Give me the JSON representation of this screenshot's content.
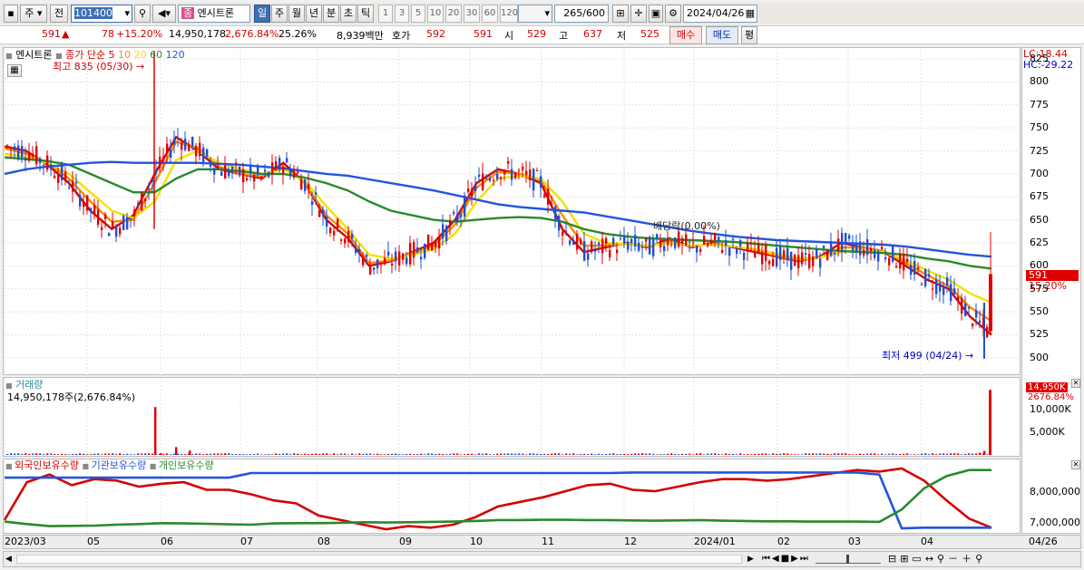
{
  "toolbar": {
    "market_btn": "주",
    "prev_btn": "전",
    "code": "101400",
    "stock_badge": "종",
    "stock_name": "엔시트론",
    "periods": [
      "일",
      "주",
      "월",
      "년",
      "분",
      "초",
      "틱"
    ],
    "selected_period": "일",
    "minute_periods": [
      "1",
      "3",
      "5",
      "10",
      "20",
      "30",
      "60",
      "120"
    ],
    "count": "265",
    "count_total": "/600",
    "date": "2024/04/26"
  },
  "quote": {
    "price": "591",
    "arrow": "▲",
    "change": "78",
    "change_pct": "+15.20%",
    "volume": "14,950,178",
    "volume_pct": "2,676.84%",
    "turnover": "25.26%",
    "amount": "8,939백만",
    "bid_label": "호가",
    "ask": "592",
    "bid": "591",
    "open_label": "시",
    "open": "529",
    "high_label": "고",
    "high": "637",
    "low_label": "저",
    "low": "525",
    "buy_btn": "매수",
    "sell_btn": "매도",
    "eval_btn": "평"
  },
  "price_panel": {
    "legend_name": "엔시트론",
    "legend_ma": "종가 단순",
    "ma_periods": [
      "5",
      "10",
      "20",
      "60",
      "120"
    ],
    "ma_colors": [
      "#d40000",
      "#ff8c00",
      "#f5e000",
      "#2a8a2a",
      "#2255dd"
    ],
    "max_label": "최고 835 (05/30)",
    "min_label": "최저 499 (04/24)",
    "dividend_label": "배당락(0.00%)",
    "lc_label": "LC:18.44",
    "hc_label": "HC:-29.22",
    "price_tag": "591",
    "pct_tag": "15.20%",
    "y_ticks": [
      "825",
      "800",
      "775",
      "750",
      "725",
      "700",
      "675",
      "650",
      "625",
      "600",
      "575",
      "550",
      "525",
      "500"
    ]
  },
  "volume_panel": {
    "title": "거래량",
    "readout": "14,950,178주(2,676.84%)",
    "tag_value": "14,950K",
    "tag_pct": "2676.84%",
    "y_ticks": [
      "10,000K",
      "5,000K"
    ]
  },
  "holding_panel": {
    "legend": [
      "외국인보유수량",
      "기관보유수량",
      "개인보유수량"
    ],
    "legend_colors": [
      "#d40000",
      "#2255dd",
      "#2a8a2a"
    ],
    "y_ticks": [
      "8,000,000",
      "7,000,000"
    ]
  },
  "x_axis": {
    "labels": [
      "2023/03",
      "05",
      "06",
      "07",
      "08",
      "09",
      "10",
      "11",
      "12",
      "2024/01",
      "02",
      "03",
      "04"
    ],
    "last_label": "04/26"
  },
  "chart_data": {
    "type": "line",
    "title": "",
    "period": "daily",
    "date_range": [
      "2023/03",
      "2024/04/26"
    ],
    "price": {
      "ylim": [
        490,
        830
      ],
      "high": {
        "value": 835,
        "date": "05/30"
      },
      "low": {
        "value": 499,
        "date": "04/24"
      },
      "last": {
        "open": 529,
        "high": 637,
        "low": 525,
        "close": 591
      },
      "series": [
        {
          "name": "5",
          "values": [
            730,
            725,
            710,
            690,
            660,
            640,
            655,
            700,
            740,
            725,
            705,
            700,
            695,
            712,
            690,
            650,
            630,
            600,
            605,
            615,
            625,
            650,
            690,
            705,
            700,
            690,
            640,
            615,
            620,
            625,
            620,
            630,
            620,
            625,
            620,
            615,
            610,
            605,
            610,
            625,
            620,
            615,
            600,
            585,
            575,
            545,
            525
          ]
        },
        {
          "name": "10",
          "values": [
            728,
            722,
            712,
            695,
            670,
            648,
            650,
            690,
            735,
            728,
            708,
            700,
            697,
            708,
            690,
            655,
            635,
            603,
            606,
            614,
            622,
            645,
            685,
            702,
            700,
            693,
            655,
            622,
            622,
            624,
            621,
            627,
            621,
            624,
            621,
            617,
            611,
            606,
            609,
            620,
            620,
            616,
            603,
            590,
            578,
            555,
            540
          ]
        },
        {
          "name": "20",
          "values": [
            722,
            718,
            712,
            700,
            680,
            660,
            652,
            670,
            715,
            725,
            712,
            705,
            700,
            705,
            692,
            665,
            640,
            612,
            608,
            612,
            618,
            635,
            670,
            695,
            698,
            695,
            670,
            635,
            625,
            624,
            622,
            625,
            622,
            623,
            621,
            618,
            613,
            608,
            609,
            615,
            618,
            615,
            606,
            595,
            585,
            570,
            560
          ]
        },
        {
          "name": "60",
          "values": [
            718,
            716,
            714,
            710,
            700,
            690,
            680,
            680,
            695,
            705,
            705,
            703,
            700,
            700,
            696,
            690,
            682,
            670,
            660,
            655,
            650,
            648,
            650,
            652,
            653,
            652,
            648,
            640,
            635,
            632,
            630,
            629,
            628,
            627,
            626,
            624,
            622,
            620,
            618,
            616,
            615,
            614,
            612,
            608,
            605,
            600,
            597
          ]
        },
        {
          "name": "120",
          "values": [
            700,
            705,
            708,
            710,
            712,
            713,
            712,
            712,
            712,
            712,
            711,
            710,
            708,
            706,
            703,
            700,
            698,
            694,
            690,
            686,
            682,
            677,
            672,
            667,
            664,
            662,
            660,
            658,
            654,
            650,
            646,
            642,
            638,
            635,
            632,
            630,
            628,
            627,
            626,
            625,
            624,
            623,
            621,
            618,
            615,
            612,
            610
          ]
        }
      ]
    },
    "volume": {
      "last": 14950178,
      "last_pct": 2676.84,
      "ylim": [
        0,
        15000000
      ],
      "spikes": [
        {
          "date": "05/30",
          "value": 11000000
        },
        {
          "date": "06",
          "value": 3000000
        },
        {
          "date": "06",
          "value": 1800000
        },
        {
          "date": "04/26",
          "value": 14950178
        }
      ]
    },
    "holdings": {
      "ylim": [
        6600000,
        8900000
      ],
      "series": [
        {
          "name": "외국인보유수량",
          "values": [
            7050000,
            8300000,
            8550000,
            8200000,
            8400000,
            8350000,
            8150000,
            8250000,
            8300000,
            8050000,
            8050000,
            7900000,
            7700000,
            7600000,
            7200000,
            7050000,
            6900000,
            6750000,
            6850000,
            6800000,
            6900000,
            7150000,
            7500000,
            7650000,
            7800000,
            8000000,
            8200000,
            8250000,
            8050000,
            8000000,
            8150000,
            8300000,
            8400000,
            8400000,
            8350000,
            8400000,
            8500000,
            8600000,
            8700000,
            8650000,
            8750000,
            8350000,
            7700000,
            7100000,
            6800000
          ]
        },
        {
          "name": "기관보유수량",
          "values": [
            8450000,
            8450000,
            8450000,
            8450000,
            8450000,
            8450000,
            8450000,
            8450000,
            8450000,
            8450000,
            8450000,
            8600000,
            8600000,
            8600000,
            8600000,
            8600000,
            8600000,
            8600000,
            8600000,
            8600000,
            8600000,
            8600000,
            8600000,
            8600000,
            8600000,
            8600000,
            8600000,
            8600000,
            8620000,
            8620000,
            8620000,
            8620000,
            8620000,
            8620000,
            8620000,
            8620000,
            8620000,
            8620000,
            8620000,
            8550000,
            6780000,
            6800000,
            6800000,
            6800000,
            6800000
          ]
        },
        {
          "name": "개인보유수량",
          "values": [
            7000000,
            6920000,
            6850000,
            6860000,
            6870000,
            6900000,
            6920000,
            6950000,
            6940000,
            6930000,
            6910000,
            6900000,
            6940000,
            6950000,
            6950000,
            6960000,
            6980000,
            6970000,
            6980000,
            6990000,
            7000000,
            7020000,
            7050000,
            7050000,
            7060000,
            7060000,
            7050000,
            7050000,
            7040000,
            7030000,
            7040000,
            7050000,
            7030000,
            7020000,
            7010000,
            7010000,
            7000000,
            7000000,
            7000000,
            6990000,
            7400000,
            8100000,
            8500000,
            8700000,
            8700000
          ]
        }
      ]
    }
  }
}
